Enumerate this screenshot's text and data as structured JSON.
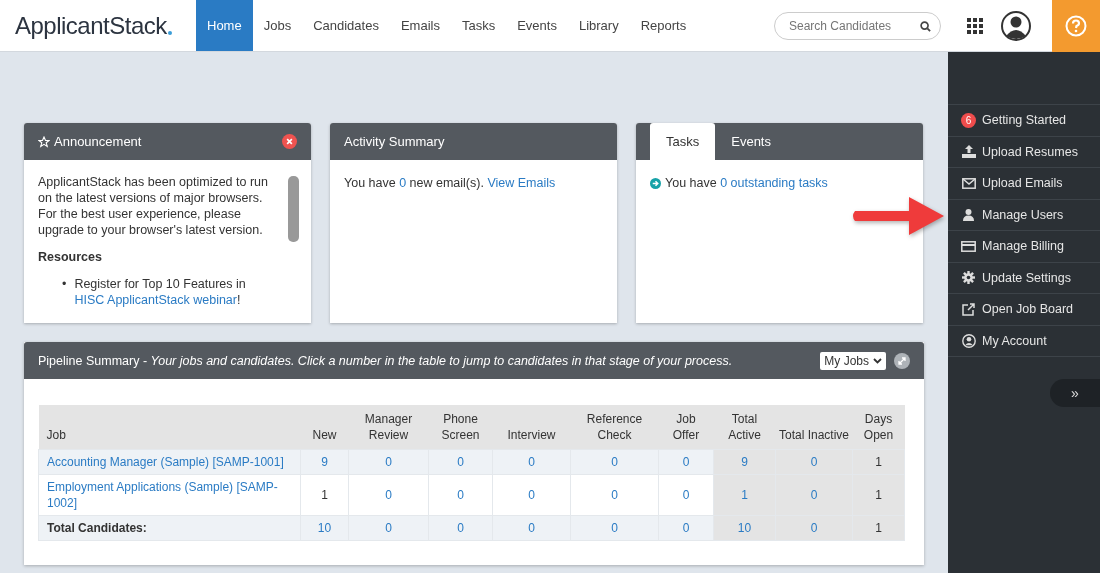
{
  "nav": {
    "logo": "ApplicantStack",
    "items": [
      {
        "label": "Home",
        "selected": true
      },
      {
        "label": "Jobs",
        "selected": false
      },
      {
        "label": "Candidates",
        "selected": false
      },
      {
        "label": "Emails",
        "selected": false
      },
      {
        "label": "Tasks",
        "selected": false
      },
      {
        "label": "Events",
        "selected": false
      },
      {
        "label": "Library",
        "selected": false
      },
      {
        "label": "Reports",
        "selected": false
      }
    ],
    "search": {
      "placeholder": "Search Candidates"
    }
  },
  "announcement": {
    "title": "Announcement",
    "body": "ApplicantStack has been optimized to run on the latest versions of major browsers. For the best user experience, please upgrade to your browser's latest version.",
    "resources_title": "Resources",
    "bullets": [
      {
        "marker": "•",
        "parts": [
          {
            "text": "Register for Top 10 Features in ",
            "link": false
          },
          {
            "text": "HISC ApplicantStack webinar",
            "link": true
          },
          {
            "text": "!",
            "link": false
          }
        ]
      }
    ]
  },
  "activity": {
    "title": "Activity Summary",
    "parts": [
      {
        "text": "You have ",
        "link": false
      },
      {
        "text": "0",
        "link": true
      },
      {
        "text": " new email(s). ",
        "link": false
      },
      {
        "text": "View Emails",
        "link": true
      }
    ]
  },
  "tasks_card": {
    "tabs": [
      {
        "label": "Tasks",
        "selected": true
      },
      {
        "label": "Events",
        "selected": false
      }
    ],
    "parts": [
      {
        "text": "You have ",
        "link": false
      },
      {
        "text": "0 outstanding tasks",
        "link": true
      }
    ]
  },
  "pipeline": {
    "title": "Pipeline Summary - *Your jobs and candidates. Click a number in the table to jump to candidates in that stage of your process.*",
    "filter": "My Jobs",
    "columns": [
      "Job",
      "New",
      "Manager Review",
      "Phone Screen",
      "Interview",
      "Reference Check",
      "Job Offer",
      "Total Active",
      "Total Inactive",
      "Days Open"
    ],
    "rows": [
      {
        "kind": "job",
        "cells": [
          {
            "text": "Accounting Manager (Sample) [SAMP-1001]",
            "link": true
          },
          {
            "text": "9",
            "link": true
          },
          {
            "text": "0",
            "link": true
          },
          {
            "text": "0",
            "link": true
          },
          {
            "text": "0",
            "link": true
          },
          {
            "text": "0",
            "link": true
          },
          {
            "text": "0",
            "link": true
          },
          {
            "text": "9",
            "link": true
          },
          {
            "text": "0",
            "link": true
          },
          {
            "text": "1",
            "link": false
          }
        ]
      },
      {
        "kind": "job",
        "cells": [
          {
            "text": "Employment Applications (Sample) [SAMP-1002]",
            "link": true
          },
          {
            "text": "1",
            "link": false
          },
          {
            "text": "0",
            "link": true
          },
          {
            "text": "0",
            "link": true
          },
          {
            "text": "0",
            "link": true
          },
          {
            "text": "0",
            "link": true
          },
          {
            "text": "0",
            "link": true
          },
          {
            "text": "1",
            "link": true
          },
          {
            "text": "0",
            "link": true
          },
          {
            "text": "1",
            "link": false
          }
        ]
      },
      {
        "kind": "total",
        "cells": [
          {
            "text": "Total Candidates:",
            "link": false
          },
          {
            "text": "10",
            "link": true
          },
          {
            "text": "0",
            "link": true
          },
          {
            "text": "0",
            "link": true
          },
          {
            "text": "0",
            "link": true
          },
          {
            "text": "0",
            "link": true
          },
          {
            "text": "0",
            "link": true
          },
          {
            "text": "10",
            "link": true
          },
          {
            "text": "0",
            "link": true
          },
          {
            "text": "1",
            "link": false
          }
        ]
      }
    ]
  },
  "sidebar": {
    "items": [
      {
        "label": "Getting Started",
        "badge": "6"
      },
      {
        "label": "Upload Resumes"
      },
      {
        "label": "Upload Emails"
      },
      {
        "label": "Manage Users"
      },
      {
        "label": "Manage Billing"
      },
      {
        "label": "Update Settings"
      },
      {
        "label": "Open Job Board"
      },
      {
        "label": "My Account"
      }
    ],
    "collapse": "»"
  }
}
